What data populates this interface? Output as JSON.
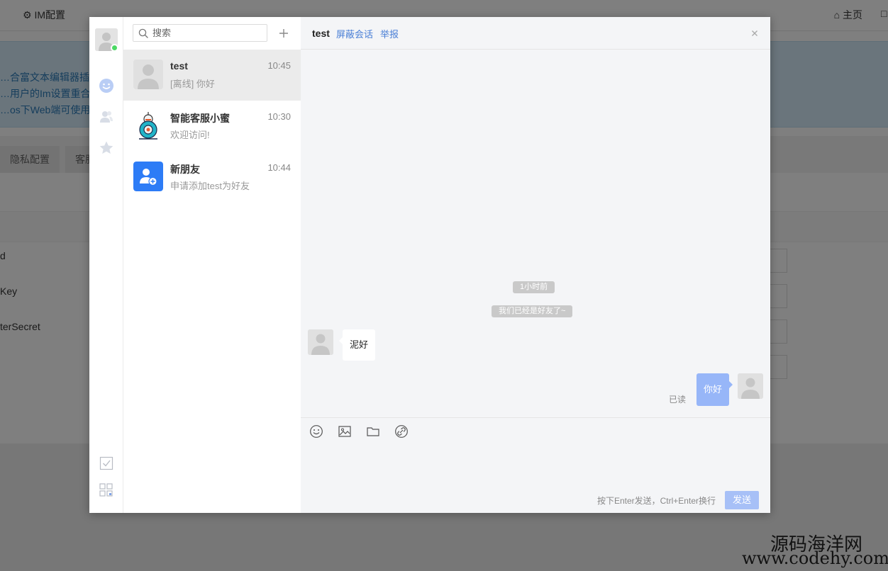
{
  "background": {
    "topbar": {
      "config_title": "IM配置",
      "home": "主页"
    },
    "notice_lines": [
      "…合富文本编辑器插件",
      "…用户的Im设置重合，",
      "…os下Web端可使用'No"
    ],
    "tabs": [
      "隐私配置",
      "客服"
    ],
    "field_labels": [
      "d",
      "Key",
      "terSecret"
    ]
  },
  "im": {
    "search": {
      "placeholder": "搜索"
    },
    "conversations": [
      {
        "name": "test",
        "time": "10:45",
        "last_message": "[离线] 你好"
      },
      {
        "name": "智能客服小蜜",
        "time": "10:30",
        "last_message": "欢迎访问!"
      },
      {
        "name": "新朋友",
        "time": "10:44",
        "last_message": "申请添加test为好友"
      }
    ],
    "chat": {
      "title": "test",
      "actions": {
        "block": "屏蔽会话",
        "report": "举报"
      },
      "time_tag": "1小时前",
      "system_message": "我们已经是好友了~",
      "incoming_message": "泥好",
      "outgoing_message": "你好",
      "read_status": "已读",
      "hint": "按下Enter发送，Ctrl+Enter换行",
      "send_label": "发送"
    },
    "colors": {
      "accent": "#4a7fd6",
      "online": "#4cd964",
      "outgoing_bubble": "#97b6f8",
      "new_friend": "#2d7cf6"
    }
  },
  "watermark": {
    "line1": "源码海洋网",
    "line2": "www.codehy.com"
  }
}
